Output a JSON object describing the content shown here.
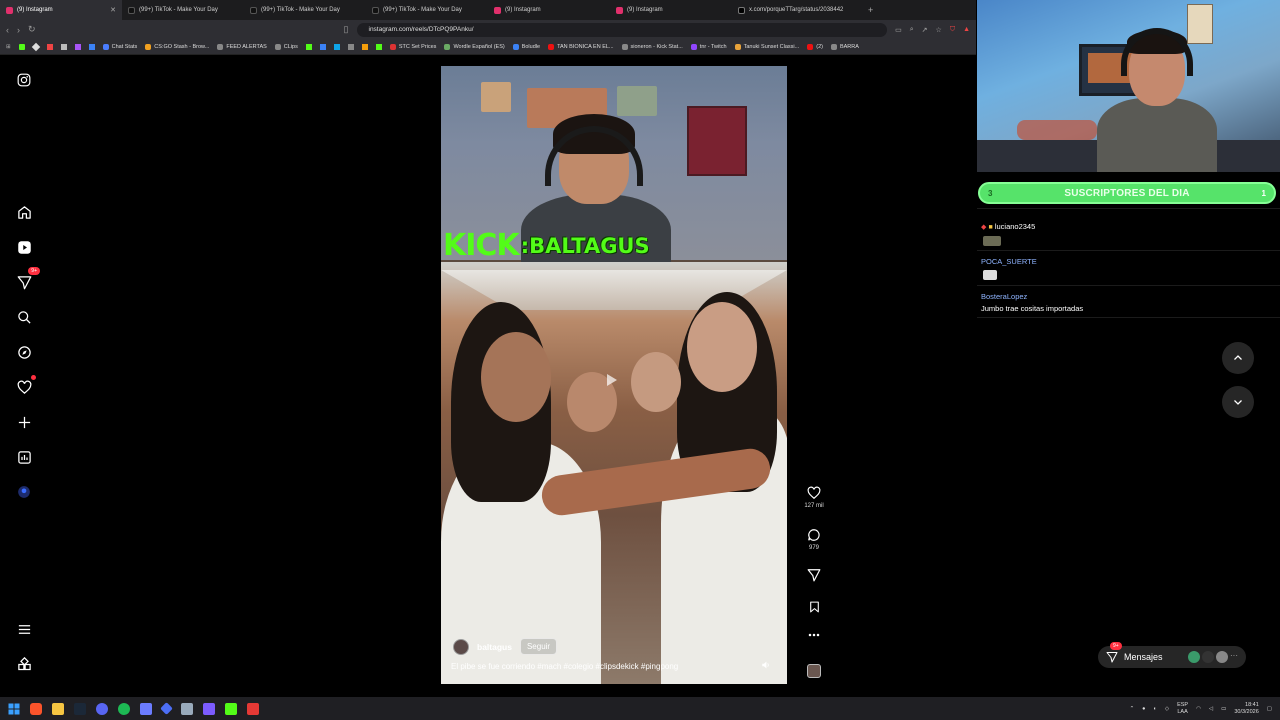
{
  "browser": {
    "tabs": [
      {
        "label": "(9) Instagram",
        "active": true,
        "color": "#e1306c"
      },
      {
        "label": "(99+) TikTok - Make Your Day",
        "active": false,
        "color": "#111111"
      },
      {
        "label": "(99+) TikTok - Make Your Day",
        "active": false,
        "color": "#111111"
      },
      {
        "label": "(99+) TikTok - Make Your Day",
        "active": false,
        "color": "#111111"
      },
      {
        "label": "(9) Instagram",
        "active": false,
        "color": "#e1306c"
      },
      {
        "label": "(9) Instagram",
        "active": false,
        "color": "#e1306c"
      },
      {
        "label": "x.com/porqueTTarg/status/2038442",
        "active": false,
        "color": "#000000"
      }
    ],
    "url": "instagram.com/reels/DTcPQ9PAnku/",
    "bookmarks": [
      {
        "label": "Chat Stats",
        "color": "#4a7dff"
      },
      {
        "label": "CS:GO Stash - Brow...",
        "color": "#f0a020"
      },
      {
        "label": "FEED ALERTAS",
        "color": "#888888"
      },
      {
        "label": "CLips",
        "color": "#888888"
      },
      {
        "label": "STC Set Prices",
        "color": "#d33"
      },
      {
        "label": "Wordle Español (ES)",
        "color": "#6aaa64"
      },
      {
        "label": "Boludle",
        "color": "#3b82f6"
      },
      {
        "label": "TAN BIONICA EN EL...",
        "color": "#e11"
      },
      {
        "label": "sioneron - Kick Stat...",
        "color": "#888888"
      },
      {
        "label": "tnr - Twitch",
        "color": "#9146ff"
      },
      {
        "label": "Tanuki Sunset Classi...",
        "color": "#e8a33a"
      },
      {
        "label": "(2)",
        "color": "#e11"
      },
      {
        "label": "BARRA",
        "color": "#888888"
      }
    ]
  },
  "sidebar": {
    "notifications_badge": "9+"
  },
  "reel": {
    "overlay_brand": "KICK",
    "overlay_user": ":BALTAGUS",
    "author": "baltagus",
    "follow_label": "Seguir",
    "caption": "El pibe se fue corriendo #mach #colegio #clipsdekick #pingpong",
    "likes": "127 mil",
    "comments": "979"
  },
  "messages": {
    "label": "Mensajes",
    "badge": "9+"
  },
  "stream": {
    "subs_title": "SUSCRIPTORES DEL DIA",
    "subs_left": "3",
    "subs_right": "1",
    "chat": [
      {
        "user": "luciano2345",
        "message": "",
        "color": "#ffffff"
      },
      {
        "user": "POCA_SUERTE",
        "message": "",
        "color": "#8fb4ff"
      },
      {
        "user": "BosteraLopez",
        "message": "Jumbo trae cositas importadas",
        "color": "#8fb4ff"
      }
    ]
  },
  "taskbar": {
    "lang_top": "ESP",
    "lang_bottom": "LAA",
    "time": "18:41",
    "date": "30/3/2026"
  },
  "colors": {
    "kick_green": "#53fc18",
    "instagram_red": "#ff3040",
    "subs_green": "#56e36a"
  }
}
